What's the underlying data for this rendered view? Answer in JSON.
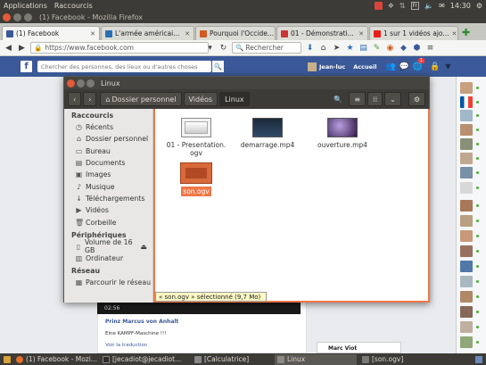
{
  "panel": {
    "menu": [
      "Applications",
      "Raccourcis"
    ],
    "keyboard": "Fr",
    "clock": "14:30"
  },
  "firefox": {
    "title": "(1) Facebook - Mozilla Firefox"
  },
  "tabs": [
    {
      "label": "(1) Facebook",
      "color": "#3b5998",
      "active": true
    },
    {
      "label": "L'armée américai...",
      "color": "#2a6fb3",
      "active": false
    },
    {
      "label": "Pourquoi l'Occide...",
      "color": "#d35a1e",
      "active": false
    },
    {
      "label": "01 - Démonstrati...",
      "color": "#cc3333",
      "active": false
    },
    {
      "label": "1 sur 1 vidéos ajo...",
      "color": "#e62117",
      "active": false
    }
  ],
  "nav": {
    "url": "https://www.facebook.com",
    "search_placeholder": "Rechercher"
  },
  "facebook": {
    "search_placeholder": "Chercher des personnes, des lieux ou d'autres choses",
    "user": "Jean-luc",
    "home": "Accueil",
    "notif": "1",
    "post": {
      "time": "02:56",
      "author": "Prinz Marcus von Anhalt",
      "text": "Eine KAMPF-Maschine !!!",
      "link": "Voir la traduction"
    },
    "chat_name": "Marc Viot"
  },
  "nautilus": {
    "title": "Linux",
    "crumbs": [
      "Dossier personnel",
      "Vidéos",
      "Linux"
    ],
    "sections": [
      {
        "title": "Raccourcis",
        "items": [
          {
            "icon": "◷",
            "label": "Récents"
          },
          {
            "icon": "⌂",
            "label": "Dossier personnel"
          },
          {
            "icon": "▭",
            "label": "Bureau"
          },
          {
            "icon": "▤",
            "label": "Documents"
          },
          {
            "icon": "▣",
            "label": "Images"
          },
          {
            "icon": "♪",
            "label": "Musique"
          },
          {
            "icon": "↓",
            "label": "Téléchargements"
          },
          {
            "icon": "▶",
            "label": "Vidéos"
          },
          {
            "icon": "🗑",
            "label": "Corbeille"
          }
        ]
      },
      {
        "title": "Périphériques",
        "items": [
          {
            "icon": "▯",
            "label": "Volume de 16 GB"
          },
          {
            "icon": "▥",
            "label": "Ordinateur"
          }
        ]
      },
      {
        "title": "Réseau",
        "items": [
          {
            "icon": "▦",
            "label": "Parcourir le réseau"
          }
        ]
      }
    ],
    "files": [
      {
        "name": "01 - Presentation. ogv",
        "selected": false
      },
      {
        "name": "demarrage.mp4",
        "selected": false
      },
      {
        "name": "ouverture.mp4",
        "selected": false
      },
      {
        "name": "son.ogv",
        "selected": true
      }
    ],
    "status": "« son.ogv » sélectionné (9,7 Mo)"
  },
  "taskbar": [
    {
      "label": "(1) Facebook - Mozi...",
      "active": false
    },
    {
      "label": "[jecadiot@jecadiot...",
      "active": false
    },
    {
      "label": "[Calculatrice]",
      "active": false
    },
    {
      "label": "Linux",
      "active": true
    },
    {
      "label": "[son.ogv]",
      "active": false
    }
  ]
}
